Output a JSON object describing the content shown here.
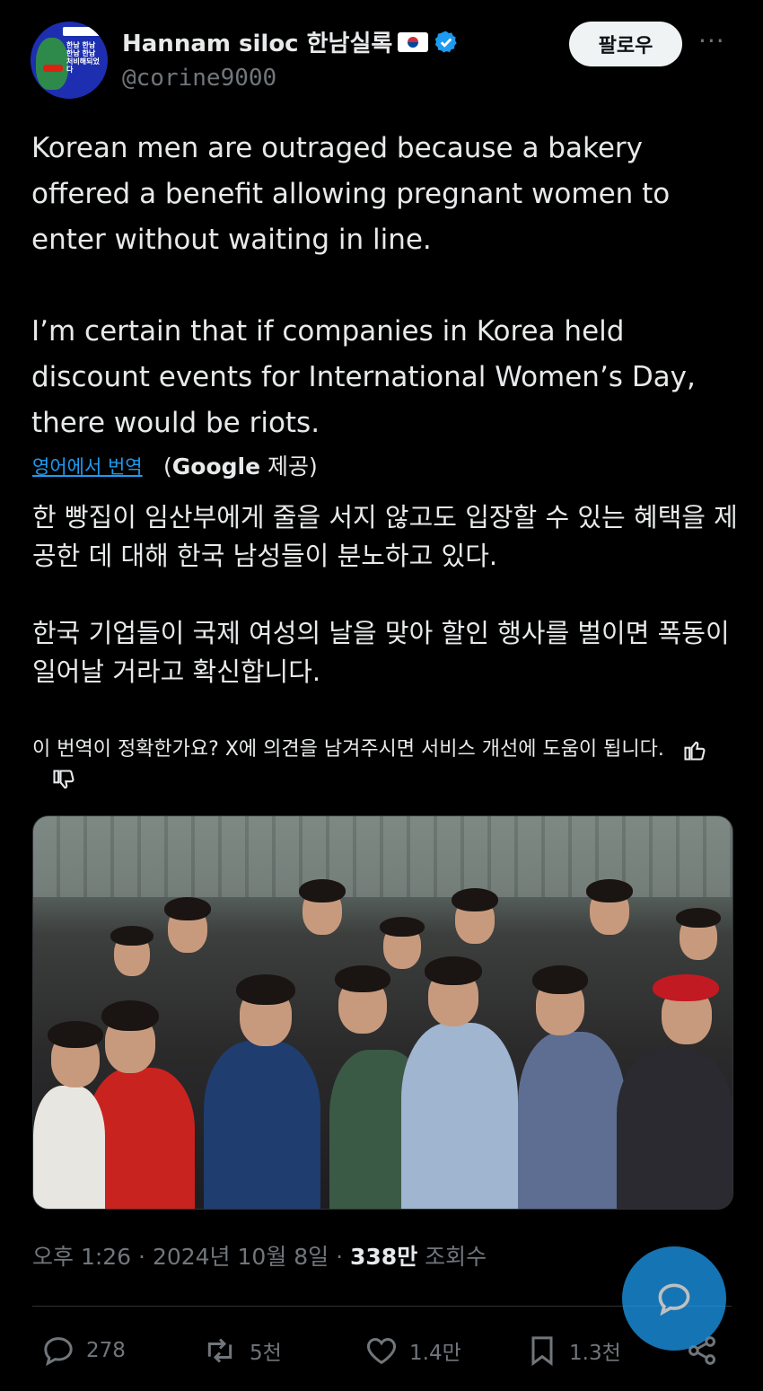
{
  "author": {
    "display_name": "Hannam siloc 한남실록",
    "handle": "@corine9000",
    "avatar_text": "한남 한남 한남 한남 처비해되었다"
  },
  "header": {
    "follow_label": "팔로우",
    "more_label": "···"
  },
  "post": {
    "paragraph1": "Korean men are outraged because a bakery offered a benefit allowing pregnant women to enter without waiting in line.",
    "paragraph2": "I’m certain that if companies in Korea held discount events for International Women’s Day, there would be riots."
  },
  "translation": {
    "translated_from_label": "영어에서 번역",
    "provider_open": "(",
    "provider_name": "Google",
    "provider_close": " 제공)",
    "paragraph1": "한 빵집이 임산부에게 줄을 서지 않고도 입장할 수 있는 혜택을 제공한 데 대해 한국 남성들이 분노하고 있다.",
    "paragraph2": "한국 기업들이 국제 여성의 날을 맞아 할인 행사를 벌이면 폭동이 일어날 거라고 확신합니다.",
    "feedback_text": "이 번역이 정확한가요? X에 의견을 남겨주시면 서비스 개선에 도움이 됩니다."
  },
  "meta": {
    "time": "오후 1:26",
    "separator": " · ",
    "date": "2024년 10월 8일",
    "views_count": "338만",
    "views_label": " 조회수"
  },
  "actions": {
    "replies": "278",
    "reposts": "5천",
    "likes": "1.4만",
    "bookmarks": "1.3천"
  },
  "colors": {
    "accent": "#1d9bf0",
    "text": "#e7e9ea",
    "muted": "#71767b",
    "background": "#000000"
  },
  "icons": [
    "more-icon",
    "verified-badge-icon",
    "flag-korea-icon",
    "thumbs-up-icon",
    "thumbs-down-icon",
    "reply-icon",
    "repost-icon",
    "like-icon",
    "bookmark-icon",
    "share-icon",
    "compose-reply-icon"
  ]
}
